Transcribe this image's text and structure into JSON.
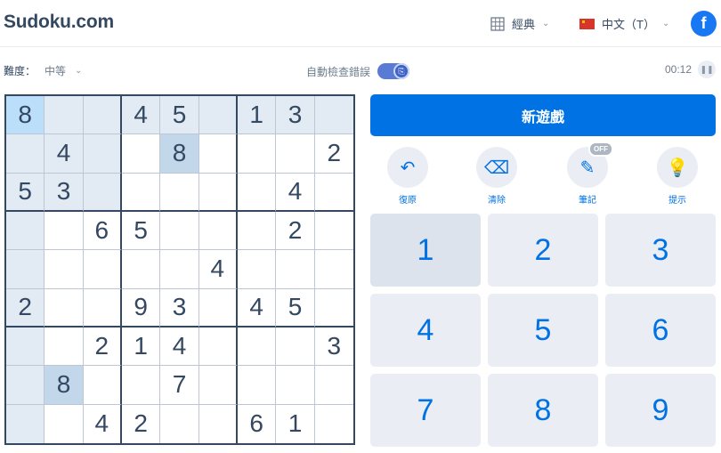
{
  "header": {
    "logo": "Sudoku.com",
    "mode": "經典",
    "language": "中文（T）",
    "facebook": "f"
  },
  "info": {
    "difficulty_label": "難度：",
    "difficulty_value": "中等",
    "autocheck_label": "自動檢查錯誤",
    "autocheck_on": true,
    "timer": "00:12"
  },
  "board": {
    "grid": [
      [
        "8",
        "",
        "",
        "4",
        "5",
        "",
        "1",
        "3",
        ""
      ],
      [
        "",
        "4",
        "",
        "",
        "8",
        "",
        "",
        "",
        "2"
      ],
      [
        "5",
        "3",
        "",
        "",
        "",
        "",
        "",
        "4",
        ""
      ],
      [
        "",
        "",
        "6",
        "5",
        "",
        "",
        "",
        "2",
        ""
      ],
      [
        "",
        "",
        "",
        "",
        "",
        "4",
        "",
        "",
        ""
      ],
      [
        "2",
        "",
        "",
        "9",
        "3",
        "",
        "4",
        "5",
        ""
      ],
      [
        "",
        "",
        "2",
        "1",
        "4",
        "",
        "",
        "",
        "3"
      ],
      [
        "",
        "8",
        "",
        "",
        "7",
        "",
        "",
        "",
        ""
      ],
      [
        "",
        "",
        "4",
        "2",
        "",
        "",
        "6",
        "1",
        ""
      ]
    ],
    "selected": [
      0,
      0
    ]
  },
  "controls": {
    "new_game": "新遊戲",
    "tools": [
      {
        "name": "undo",
        "label": "復原",
        "icon": "undo-icon",
        "glyph": "↶"
      },
      {
        "name": "erase",
        "label": "清除",
        "icon": "eraser-icon",
        "glyph": "⌫"
      },
      {
        "name": "notes",
        "label": "筆記",
        "icon": "pencil-icon",
        "glyph": "✎",
        "badge": "OFF"
      },
      {
        "name": "hint",
        "label": "提示",
        "icon": "lightbulb-icon",
        "glyph": "💡"
      }
    ],
    "numbers": [
      "1",
      "2",
      "3",
      "4",
      "5",
      "6",
      "7",
      "8",
      "9"
    ]
  },
  "colors": {
    "accent": "#0072e3",
    "selected_cell": "#bbdefb",
    "highlight_cell": "#e2ebf3",
    "same_number_cell": "#c3d7ea"
  }
}
